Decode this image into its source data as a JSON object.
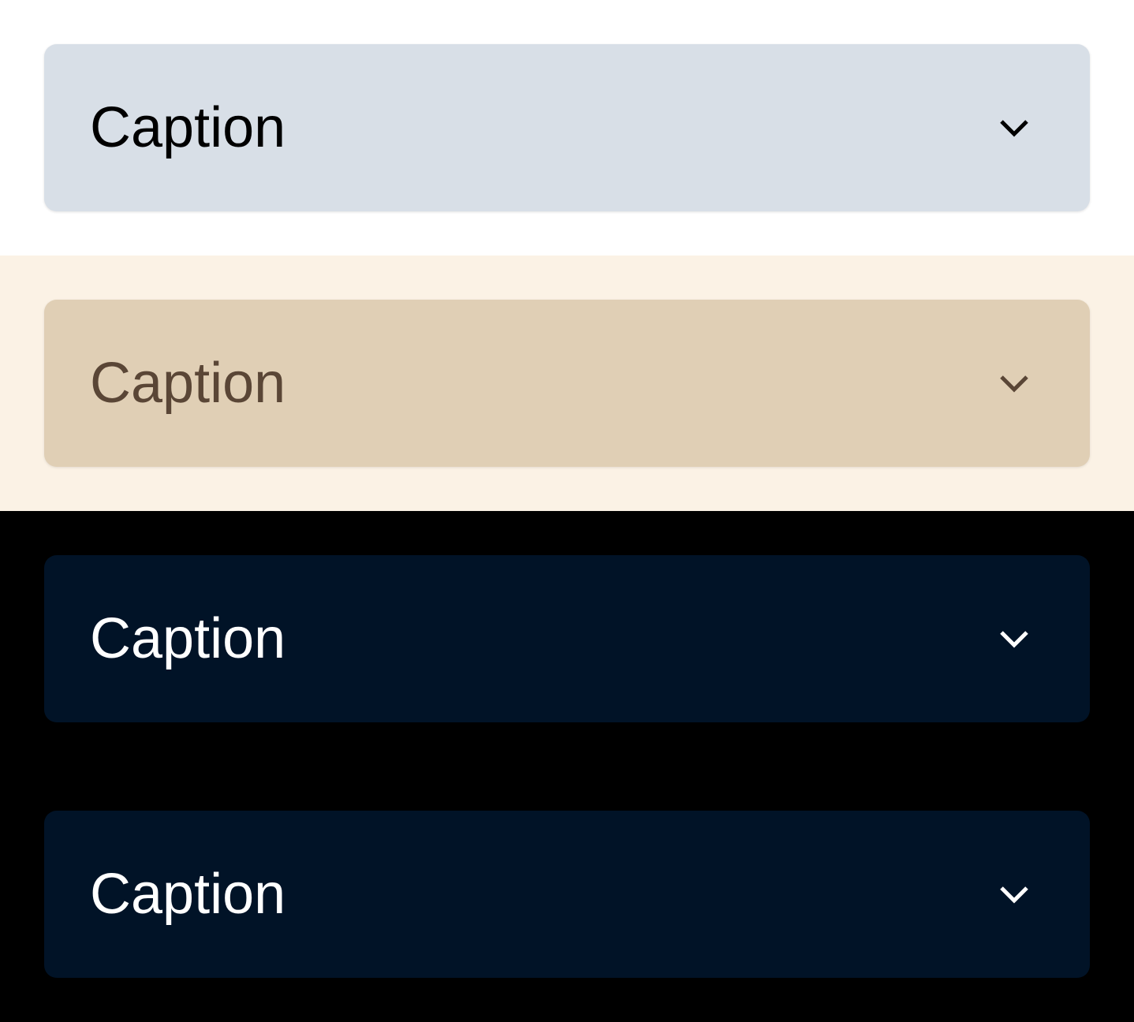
{
  "dropdowns": [
    {
      "theme": "light",
      "label": "Caption",
      "icon": "chevron-down-icon",
      "color": "#d8dfe7"
    },
    {
      "theme": "sepia",
      "label": "Caption",
      "icon": "chevron-down-icon",
      "color": "#e0cfb5"
    },
    {
      "theme": "dark",
      "label": "Caption",
      "icon": "chevron-down-icon",
      "color": "#011327"
    },
    {
      "theme": "dark",
      "label": "Caption",
      "icon": "chevron-down-icon",
      "color": "#011327"
    }
  ]
}
